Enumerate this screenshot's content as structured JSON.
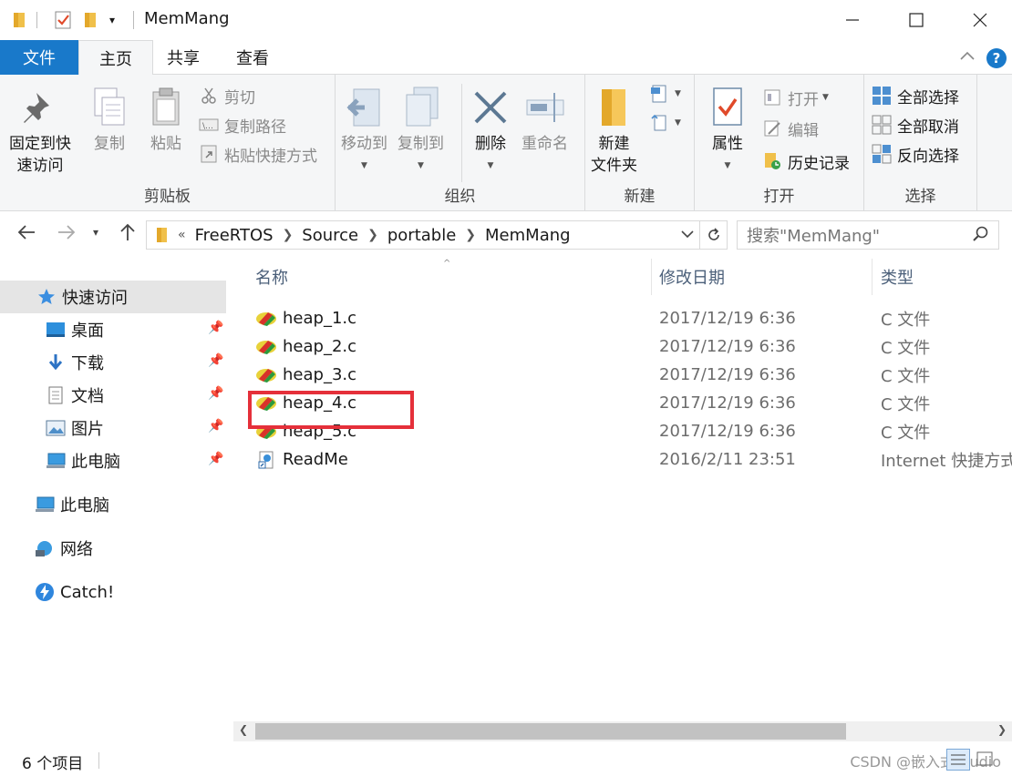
{
  "window": {
    "title": "MemMang"
  },
  "ribbon_tabs": {
    "file": "文件",
    "home": "主页",
    "share": "共享",
    "view": "查看"
  },
  "clipboard": {
    "pin_line1": "固定到快",
    "pin_line2": "速访问",
    "copy": "复制",
    "paste": "粘贴",
    "cut": "剪切",
    "copy_path": "复制路径",
    "paste_shortcut": "粘贴快捷方式",
    "label": "剪贴板"
  },
  "organize": {
    "move_to": "移动到",
    "copy_to": "复制到",
    "delete": "删除",
    "rename": "重命名",
    "label": "组织"
  },
  "new": {
    "new_folder_line1": "新建",
    "new_folder_line2": "文件夹",
    "label": "新建"
  },
  "open": {
    "properties": "属性",
    "open": "打开",
    "edit": "编辑",
    "history": "历史记录",
    "label": "打开"
  },
  "select": {
    "select_all": "全部选择",
    "select_none": "全部取消",
    "invert": "反向选择",
    "label": "选择"
  },
  "address": {
    "overflow": "«",
    "crumbs": [
      "FreeRTOS",
      "Source",
      "portable",
      "MemMang"
    ]
  },
  "search": {
    "placeholder": "搜索\"MemMang\""
  },
  "nav": {
    "quick_access": "快速访问",
    "items": [
      "桌面",
      "下载",
      "文档",
      "图片",
      "此电脑"
    ],
    "this_pc": "此电脑",
    "network": "网络",
    "catch": "Catch!"
  },
  "columns": {
    "name": "名称",
    "date": "修改日期",
    "type": "类型"
  },
  "files": [
    {
      "name": "heap_1.c",
      "date": "2017/12/19 6:36",
      "type": "C 文件"
    },
    {
      "name": "heap_2.c",
      "date": "2017/12/19 6:36",
      "type": "C 文件"
    },
    {
      "name": "heap_3.c",
      "date": "2017/12/19 6:36",
      "type": "C 文件"
    },
    {
      "name": "heap_4.c",
      "date": "2017/12/19 6:36",
      "type": "C 文件"
    },
    {
      "name": "heap_5.c",
      "date": "2017/12/19 6:36",
      "type": "C 文件"
    },
    {
      "name": "ReadMe",
      "date": "2016/2/11 23:51",
      "type": "Internet 快捷方式"
    }
  ],
  "status": {
    "count": "6 个项目",
    "watermark": "CSDN @嵌入式Studio"
  },
  "colors": {
    "accent": "#1979ca",
    "highlight": "#e5303a"
  }
}
